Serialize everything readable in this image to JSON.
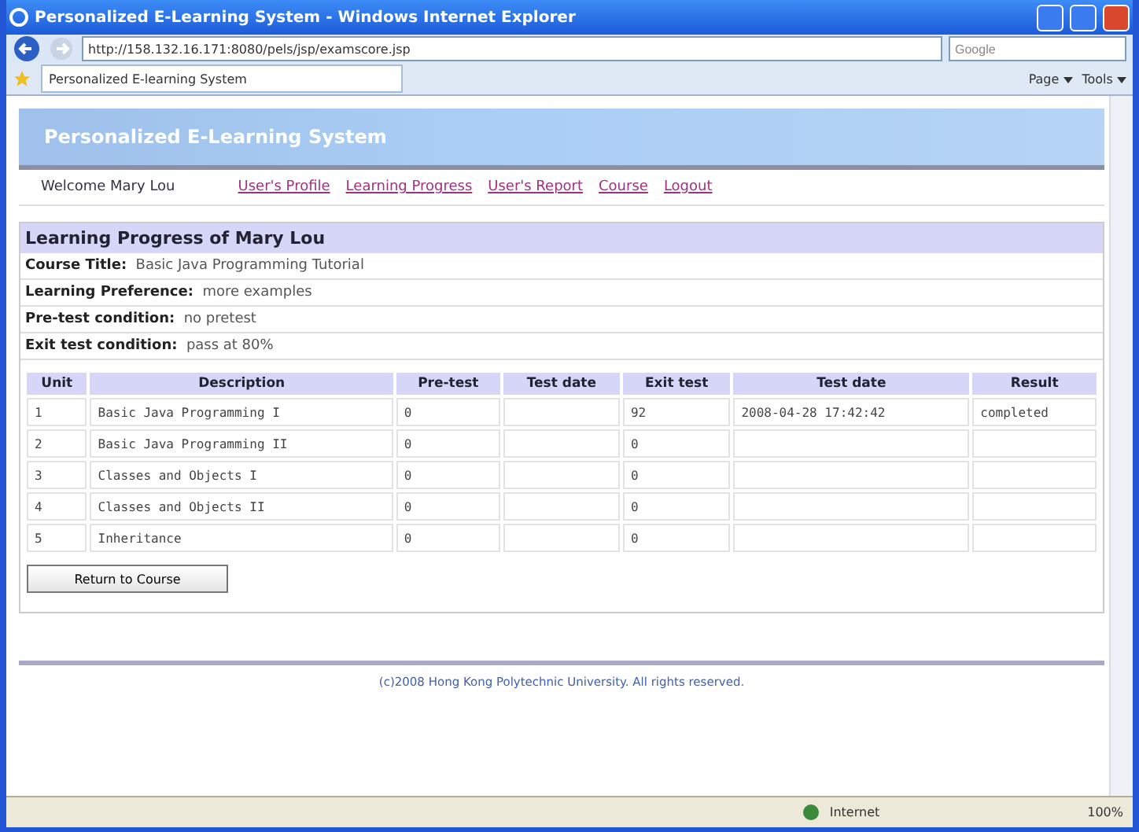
{
  "window": {
    "title": "Personalized E-Learning System - Windows Internet Explorer"
  },
  "address_bar": {
    "url": "http://158.132.16.171:8080/pels/jsp/examscore.jsp",
    "search_placeholder": "Google"
  },
  "tab": {
    "label": "Personalized E-learning System"
  },
  "toolbar": {
    "items": [
      "Page",
      "Tools"
    ]
  },
  "page": {
    "banner_title": "Personalized E-Learning System",
    "welcome": "Welcome Mary Lou",
    "nav_links": [
      "User's Profile",
      "Learning Progress",
      "User's Report",
      "Course",
      "Logout"
    ],
    "heading": "Learning Progress of Mary Lou",
    "info": [
      {
        "label": "Course Title:",
        "value": "Basic Java Programming Tutorial"
      },
      {
        "label": "Learning Preference:",
        "value": "more examples"
      },
      {
        "label": "Pre-test condition:",
        "value": "no pretest"
      },
      {
        "label": "Exit test condition:",
        "value": "pass at 80%"
      }
    ],
    "table": {
      "columns": [
        "Unit",
        "Description",
        "Pre-test",
        "Test date",
        "Exit test",
        "Test date",
        "Result"
      ],
      "rows": [
        [
          "1",
          "Basic Java Programming I",
          "0",
          "",
          "92",
          "2008-04-28 17:42:42",
          "completed"
        ],
        [
          "2",
          "Basic Java Programming II",
          "0",
          "",
          "0",
          "",
          ""
        ],
        [
          "3",
          "Classes and Objects I",
          "0",
          "",
          "0",
          "",
          ""
        ],
        [
          "4",
          "Classes and Objects II",
          "0",
          "",
          "0",
          "",
          ""
        ],
        [
          "5",
          "Inheritance",
          "0",
          "",
          "0",
          "",
          ""
        ]
      ]
    },
    "button": "Return to Course",
    "footer": "(c)2008 Hong Kong Polytechnic University. All rights reserved."
  },
  "status_bar": {
    "zone": "Internet",
    "zoom": "100%"
  }
}
